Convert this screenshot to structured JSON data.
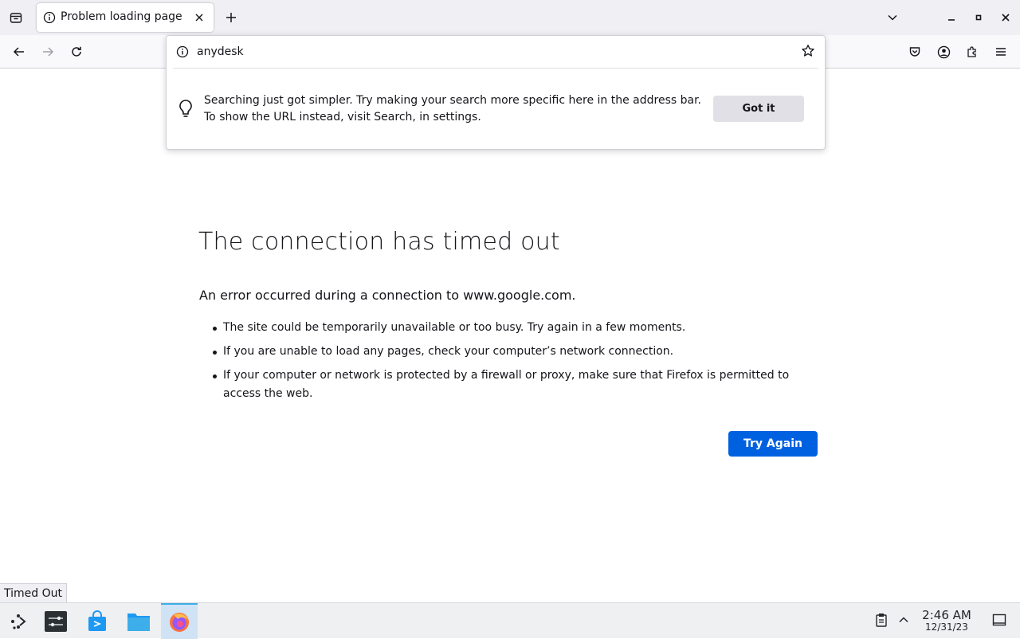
{
  "browser": {
    "tab": {
      "title": "Problem loading page"
    },
    "url_popup": {
      "value": "anydesk",
      "tip_line1": "Searching just got simpler. Try making your search more specific here in the address bar.",
      "tip_line2": "To show the URL instead, visit Search, in settings.",
      "got_it_label": "Got it"
    }
  },
  "error_page": {
    "title": "The connection has timed out",
    "description": "An error occurred during a connection to www.google.com.",
    "items": [
      "The site could be temporarily unavailable or too busy. Try again in a few moments.",
      "If you are unable to load any pages, check your computer’s network connection.",
      "If your computer or network is protected by a firewall or proxy, make sure that Firefox is permitted to access the web."
    ],
    "try_again_label": "Try Again"
  },
  "status_tooltip": "Timed Out",
  "taskbar": {
    "time": "2:46 AM",
    "date": "12/31/23"
  },
  "colors": {
    "accent": "#0061e0",
    "taskbar_active": "#cfe3f5"
  }
}
